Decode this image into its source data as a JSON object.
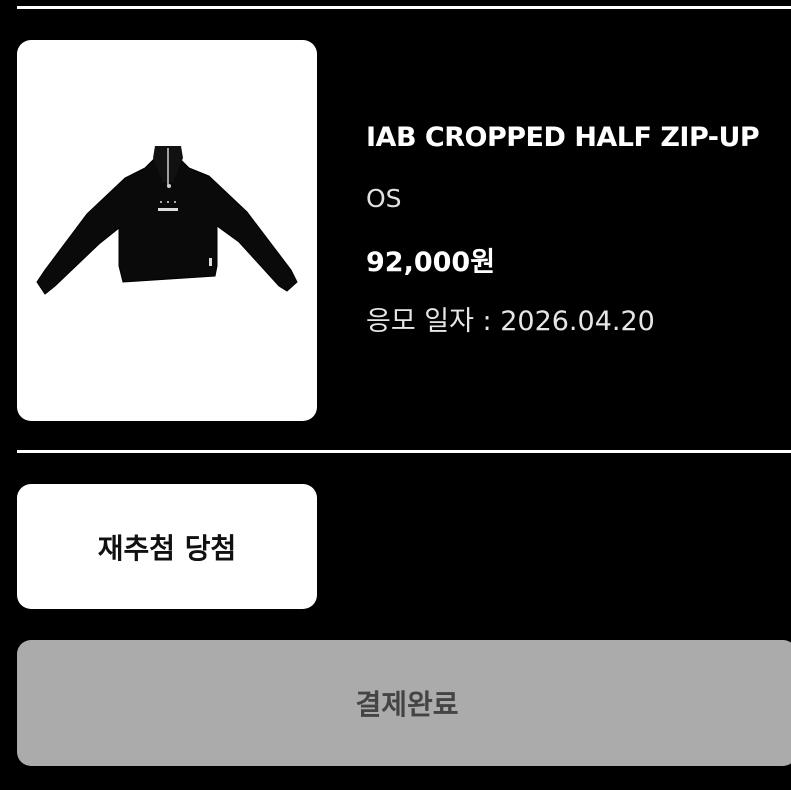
{
  "product": {
    "name": "IAB CROPPED HALF ZIP-UP",
    "option": "OS",
    "price": "92,000원",
    "date_label": "응모 일자 : ",
    "date_value": "2026.04.20",
    "image": "product-photo-black-half-zip-sweatshirt"
  },
  "status": {
    "label": "재추첨 당첨"
  },
  "payment": {
    "button_label": "결제완료",
    "button_color": "#ababab"
  },
  "colors": {
    "background": "#000000",
    "card": "#ffffff",
    "text": "#ffffff"
  }
}
